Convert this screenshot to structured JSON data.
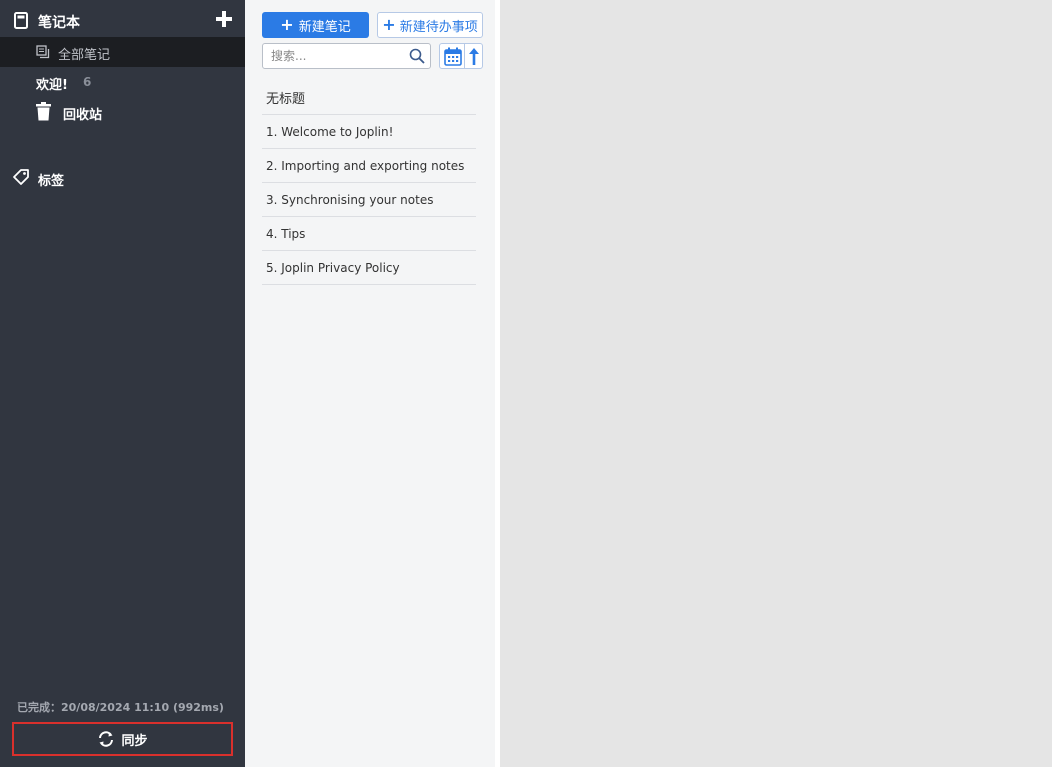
{
  "sidebar": {
    "header_title": "笔记本",
    "all_notes_label": "全部笔记",
    "notebook": {
      "label": "欢迎!",
      "count": "6"
    },
    "trash_label": "回收站",
    "tags_label": "标签",
    "sync_status": "已完成：20/08/2024 11:10  (992ms)",
    "sync_button_label": "同步"
  },
  "notelist": {
    "new_note_label": "新建笔记",
    "new_todo_label": "新建待办事项",
    "search_placeholder": "搜索...",
    "notes": [
      {
        "title": "无标题"
      },
      {
        "title": "1. Welcome to Joplin!"
      },
      {
        "title": "2. Importing and exporting notes"
      },
      {
        "title": "3. Synchronising your notes"
      },
      {
        "title": "4. Tips"
      },
      {
        "title": "5. Joplin Privacy Policy"
      }
    ]
  },
  "colors": {
    "sidebar_bg": "#313640",
    "accent": "#2b7be5",
    "sync_highlight": "#d9302c",
    "notelist_bg": "#f4f5f6",
    "editor_bg": "#e5e5e5"
  },
  "icons": [
    "notebook-icon",
    "add-notebook-icon",
    "all-notes-icon",
    "trash-icon",
    "tag-icon",
    "sync-icon",
    "search-icon",
    "calendar-sort-icon",
    "sort-order-arrow-icon"
  ]
}
